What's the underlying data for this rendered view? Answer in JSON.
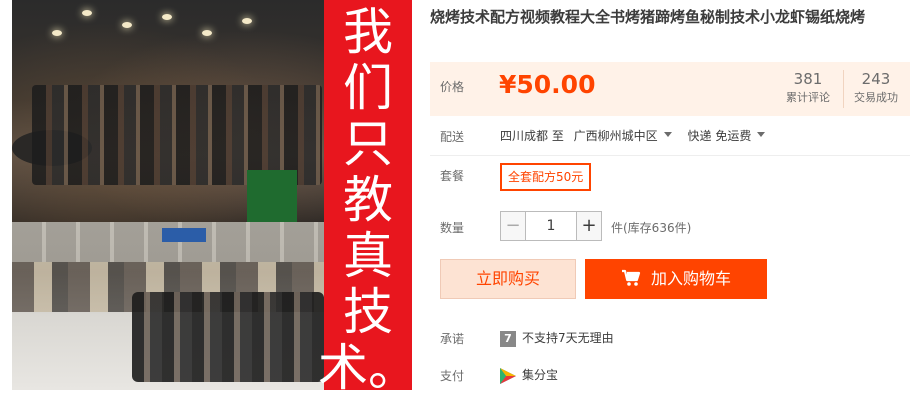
{
  "banner": {
    "chars": [
      "我",
      "们",
      "只",
      "教",
      "真",
      "技",
      "术。"
    ]
  },
  "product": {
    "title": "烧烤技术配方视频教程大全书烤猪蹄烤鱼秘制技术小龙虾锡纸烧烤"
  },
  "price": {
    "label": "价格",
    "value": "¥50.00",
    "comments_count": "381",
    "comments_label": "累计评论",
    "deals_count": "243",
    "deals_label": "交易成功"
  },
  "shipping": {
    "label": "配送",
    "from": "四川成都 至",
    "to": "广西柳州城中区",
    "method": "快递 免运费"
  },
  "package": {
    "label": "套餐",
    "option": "全套配方50元"
  },
  "quantity": {
    "label": "数量",
    "value": "1",
    "minus": "−",
    "plus": "+",
    "stock": "件(库存636件)"
  },
  "actions": {
    "buy_now": "立即购买",
    "add_cart": "加入购物车"
  },
  "promise": {
    "label": "承诺",
    "badge": "7",
    "text": "不支持7天无理由"
  },
  "payment": {
    "label": "支付",
    "icon": "jifenbao-icon",
    "text": "集分宝"
  },
  "colors": {
    "accent": "#ff4400",
    "banner_red": "#e8161e",
    "price_bg": "#fff2e8"
  }
}
